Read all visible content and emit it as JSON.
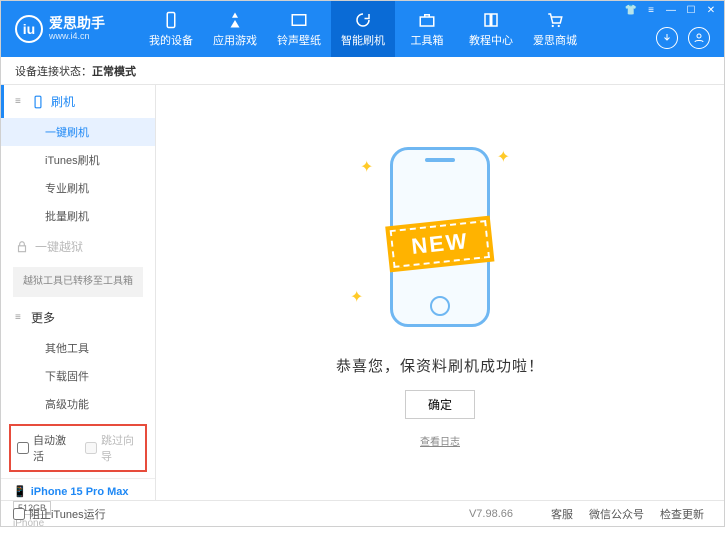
{
  "app": {
    "title": "爱思助手",
    "url": "www.i4.cn"
  },
  "nav": {
    "items": [
      {
        "label": "我的设备"
      },
      {
        "label": "应用游戏"
      },
      {
        "label": "铃声壁纸"
      },
      {
        "label": "智能刷机"
      },
      {
        "label": "工具箱"
      },
      {
        "label": "教程中心"
      },
      {
        "label": "爱思商城"
      }
    ]
  },
  "status": {
    "prefix": "设备连接状态：",
    "mode": "正常模式"
  },
  "sidebar": {
    "flash": {
      "head": "刷机",
      "items": [
        "一键刷机",
        "iTunes刷机",
        "专业刷机",
        "批量刷机"
      ]
    },
    "jailbreak": {
      "head": "一键越狱",
      "note": "越狱工具已转移至工具箱"
    },
    "more": {
      "head": "更多",
      "items": [
        "其他工具",
        "下载固件",
        "高级功能"
      ]
    },
    "checkboxes": {
      "auto_activate": "自动激活",
      "skip_guide": "跳过向导"
    }
  },
  "device": {
    "name": "iPhone 15 Pro Max",
    "capacity": "512GB",
    "type": "iPhone"
  },
  "main": {
    "ribbon": "NEW",
    "success": "恭喜您，保资料刷机成功啦！",
    "ok": "确定",
    "view_log": "查看日志"
  },
  "footer": {
    "block_itunes": "阻止iTunes运行",
    "version": "V7.98.66",
    "links": [
      "客服",
      "微信公众号",
      "检查更新"
    ]
  }
}
